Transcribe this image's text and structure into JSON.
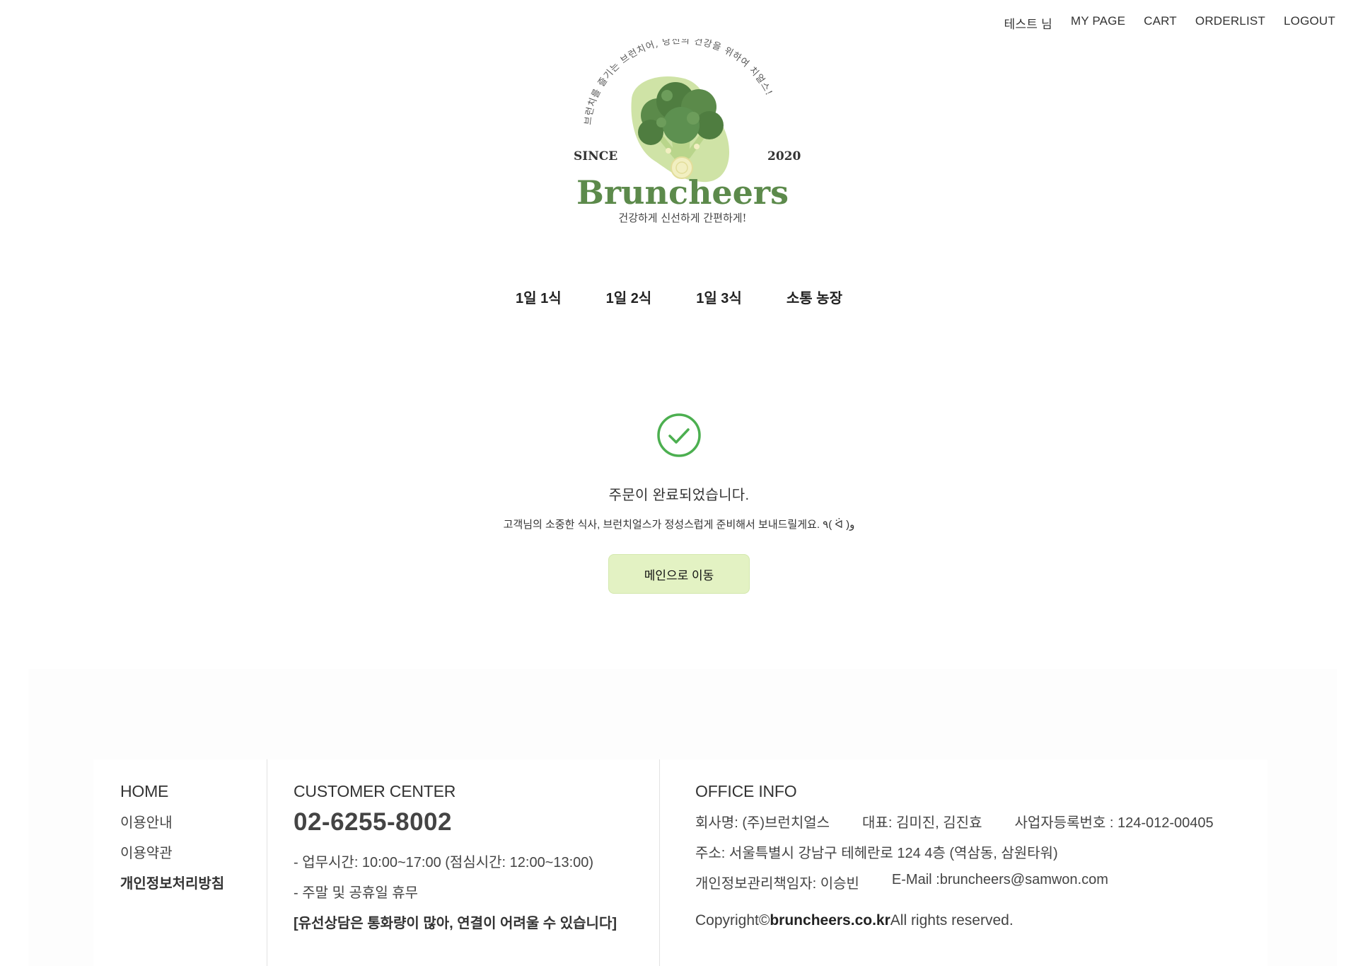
{
  "top_nav": {
    "user": "테스트 님",
    "my_page": "MY PAGE",
    "cart": "CART",
    "orderlist": "ORDERLIST",
    "logout": "LOGOUT"
  },
  "logo": {
    "arc_text": "브런치를 즐기는 브런치어, 당신의 건강을 위하여 치얼스!",
    "since": "SINCE",
    "year": "2020",
    "brand": "Bruncheers",
    "slogan": "건강하게 신선하게 간편하게!"
  },
  "main_menu": [
    "1일 1식",
    "1일 2식",
    "1일 3식",
    "소통 농장"
  ],
  "order_complete": {
    "title": "주문이 완료되었습니다.",
    "message": "고객님의 소중한 식사, 브런치얼스가 정성스럽게 준비해서 보내드릴게요. ٩( ᐛ )و",
    "button": "메인으로 이동",
    "accent_color": "#4caf50",
    "button_color": "#e3f2c3"
  },
  "footer": {
    "col1": {
      "heading": "HOME",
      "links": [
        "이용안내",
        "이용약관",
        "개인정보처리방침"
      ]
    },
    "col2": {
      "heading": "CUSTOMER CENTER",
      "phone": "02-6255-8002",
      "hours": "- 업무시간: 10:00~17:00 (점심시간: 12:00~13:00)",
      "holiday": "- 주말 및 공휴일 휴무",
      "notice": "[유선상담은 통화량이 많아, 연결이 어려울 수 있습니다]"
    },
    "col3": {
      "heading": "OFFICE INFO",
      "company": "회사명: (주)브런치얼스",
      "ceo": "대표: 김미진, 김진효",
      "biz_no": "사업자등록번호 : 124-012-00405",
      "address": "주소: 서울특별시 강남구 테헤란로 124 4층 (역삼동, 삼원타워)",
      "privacy_officer": "개인정보관리책임자: 이승빈",
      "email": "E-Mail :bruncheers@samwon.com",
      "copyright_pre": "Copyright©",
      "copyright_domain": "bruncheers.co.kr",
      "copyright_post": "All rights reserved."
    }
  }
}
